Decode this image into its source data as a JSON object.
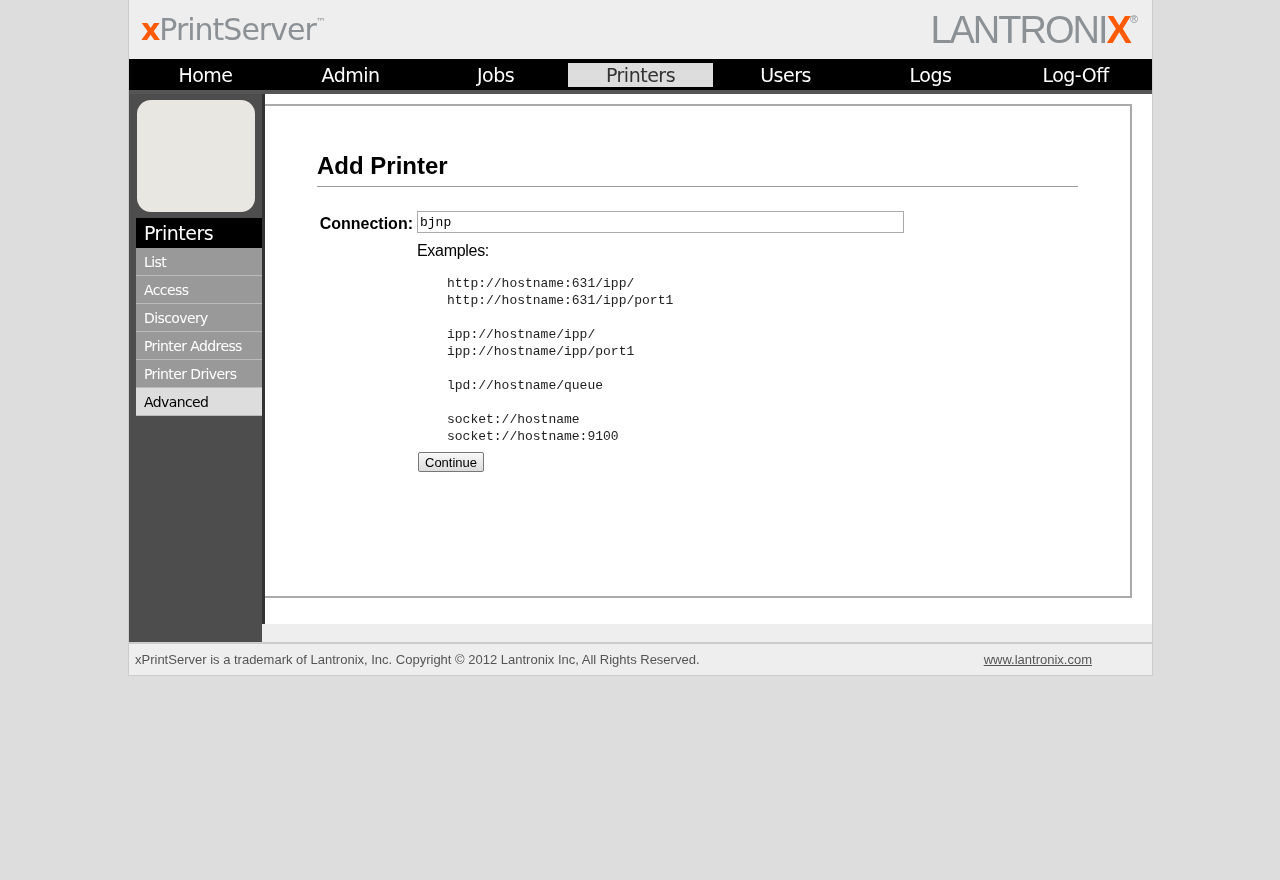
{
  "header": {
    "product_logo": {
      "accent": "x",
      "name": "PrintServer",
      "mark": "™"
    },
    "brand_logo": {
      "name": "LANTRONI",
      "accent": "X",
      "mark": "®"
    }
  },
  "nav": [
    {
      "label": "Home",
      "selected": false
    },
    {
      "label": "Admin",
      "selected": false
    },
    {
      "label": "Jobs",
      "selected": false
    },
    {
      "label": "Printers",
      "selected": true
    },
    {
      "label": "Users",
      "selected": false
    },
    {
      "label": "Logs",
      "selected": false
    },
    {
      "label": "Log-Off",
      "selected": false
    }
  ],
  "sidebar": {
    "title": "Printers",
    "items": [
      {
        "label": "List",
        "selected": false
      },
      {
        "label": "Access",
        "selected": false
      },
      {
        "label": "Discovery",
        "selected": false
      },
      {
        "label": "Printer Address",
        "selected": false
      },
      {
        "label": "Printer Drivers",
        "selected": false
      },
      {
        "label": "Advanced",
        "selected": true
      }
    ]
  },
  "form": {
    "title": "Add Printer",
    "connection_label": "Connection:",
    "connection_value": "bjnp",
    "examples_label": "Examples:",
    "example_groups": [
      [
        "http://hostname:631/ipp/",
        "http://hostname:631/ipp/port1"
      ],
      [
        "ipp://hostname/ipp/",
        "ipp://hostname/ipp/port1"
      ],
      [
        "lpd://hostname/queue"
      ],
      [
        "socket://hostname",
        "socket://hostname:9100"
      ]
    ],
    "button": "Continue"
  },
  "footer": {
    "text": "xPrintServer is a trademark of Lantronix, Inc. Copyright © 2012 Lantronix Inc, All Rights Reserved.",
    "link": "www.lantronix.com"
  }
}
